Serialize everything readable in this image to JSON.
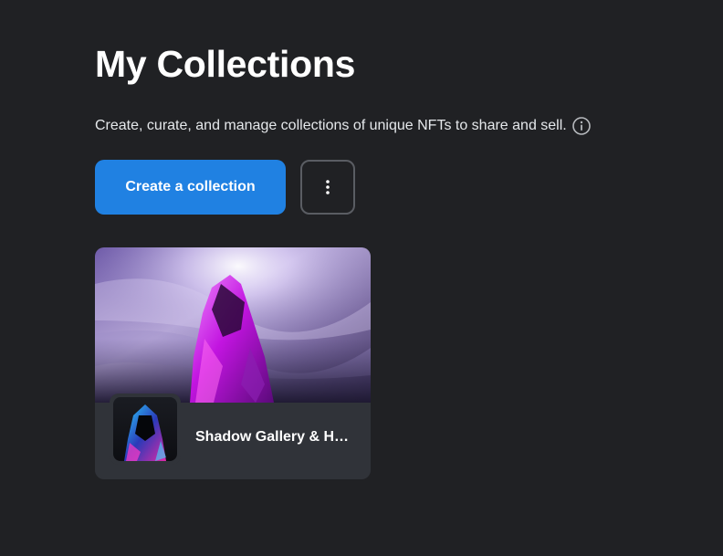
{
  "page": {
    "title": "My Collections",
    "subtitle": "Create, curate, and manage collections of unique NFTs to share and sell."
  },
  "icons": {
    "info": "info-circle-icon",
    "more": "more-vertical-icon"
  },
  "actions": {
    "create_label": "Create a collection"
  },
  "collections": [
    {
      "name": "Shadow Gallery & Hooded Figures"
    }
  ],
  "colors": {
    "background": "#202124",
    "accent": "#2081e2",
    "card": "#303339",
    "text": "#e5e8eb"
  }
}
